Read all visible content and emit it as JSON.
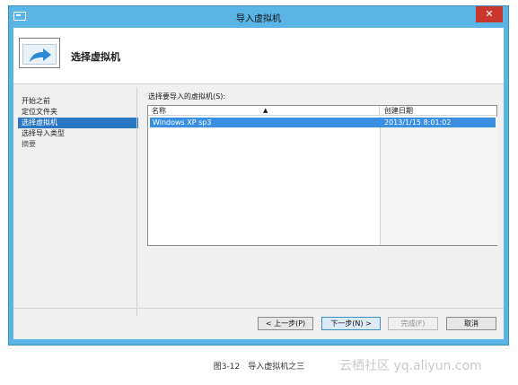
{
  "window": {
    "title": "导入虚拟机",
    "close_symbol": "✕"
  },
  "header": {
    "title": "选择虚拟机"
  },
  "nav": {
    "items": [
      {
        "label": "开始之前",
        "state": "normal"
      },
      {
        "label": "定位文件夹",
        "state": "normal"
      },
      {
        "label": "选择虚拟机",
        "state": "active"
      },
      {
        "label": "选择导入类型",
        "state": "normal"
      },
      {
        "label": "摘要",
        "state": "dim"
      }
    ]
  },
  "list": {
    "label": "选择要导入的虚拟机(S):",
    "columns": [
      "名称",
      "创建日期"
    ],
    "sort_indicator": "▲",
    "rows": [
      {
        "name": "Windows XP sp3",
        "created": "2013/1/15 8:01:02",
        "selected": true
      }
    ]
  },
  "buttons": {
    "previous": "< 上一步(P)",
    "next": "下一步(N) >",
    "finish": "完成(F)",
    "cancel": "取消"
  },
  "caption": "图3-12　导入虚拟机之三",
  "watermark": "云栖社区 yq.aliyun.com",
  "colors": {
    "titlebar": "#5ab4e6",
    "selection": "#3a8fe2",
    "nav_active": "#2c77c4",
    "close": "#c8362f"
  },
  "icons": {
    "header": "import-arrow-icon",
    "system": "window-system-icon"
  }
}
